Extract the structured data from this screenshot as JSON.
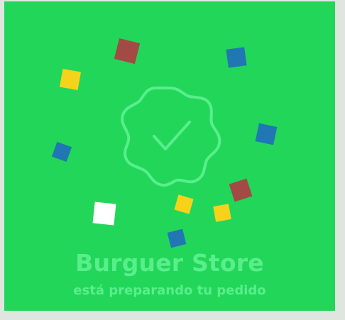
{
  "store": {
    "name": "Burguer Store",
    "status": "está preparando tu pedido"
  },
  "icons": {
    "badge": "check-badge-icon"
  },
  "colors": {
    "background": "#22d65a",
    "text": "#58ef8b",
    "badge_stroke": "#58ef8b",
    "confetti_red": "#a34a45",
    "confetti_blue": "#2077b4",
    "confetti_yellow": "#f7d21b",
    "confetti_white": "#ffffff"
  }
}
